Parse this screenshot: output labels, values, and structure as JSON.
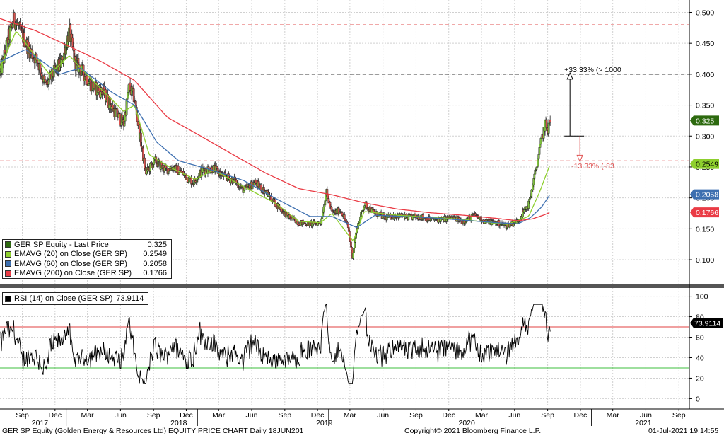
{
  "chart_data": [
    {
      "type": "candlestick",
      "ylim": [
        0.06,
        0.52
      ],
      "yticks": [
        0.1,
        0.15,
        0.2,
        0.25,
        0.3,
        0.35,
        0.4,
        0.45,
        0.5
      ],
      "ytick_labels": [
        "0.100",
        "0.150",
        "0.200",
        "0.250",
        "0.300",
        "0.350",
        "0.400",
        "0.450",
        "0.500"
      ],
      "grid": true,
      "legend_position": "bottom-left",
      "price_anchors": [
        [
          "2016-07-01",
          0.4
        ],
        [
          "2016-07-25",
          0.46
        ],
        [
          "2016-08-10",
          0.49
        ],
        [
          "2016-08-25",
          0.47
        ],
        [
          "2016-09-20",
          0.44
        ],
        [
          "2016-10-15",
          0.42
        ],
        [
          "2016-11-05",
          0.38
        ],
        [
          "2016-11-25",
          0.4
        ],
        [
          "2016-12-20",
          0.42
        ],
        [
          "2017-01-10",
          0.47
        ],
        [
          "2017-01-25",
          0.42
        ],
        [
          "2017-02-20",
          0.4
        ],
        [
          "2017-03-15",
          0.38
        ],
        [
          "2017-04-15",
          0.37
        ],
        [
          "2017-05-15",
          0.34
        ],
        [
          "2017-06-10",
          0.32
        ],
        [
          "2017-06-25",
          0.38
        ],
        [
          "2017-07-10",
          0.36
        ],
        [
          "2017-07-25",
          0.3
        ],
        [
          "2017-08-10",
          0.24
        ],
        [
          "2017-09-05",
          0.26
        ],
        [
          "2017-10-05",
          0.245
        ],
        [
          "2017-10-25",
          0.25
        ],
        [
          "2017-11-20",
          0.24
        ],
        [
          "2017-12-20",
          0.225
        ],
        [
          "2018-01-15",
          0.245
        ],
        [
          "2018-02-15",
          0.248
        ],
        [
          "2018-03-15",
          0.235
        ],
        [
          "2018-04-15",
          0.228
        ],
        [
          "2018-05-10",
          0.212
        ],
        [
          "2018-06-10",
          0.225
        ],
        [
          "2018-07-10",
          0.21
        ],
        [
          "2018-08-10",
          0.188
        ],
        [
          "2018-09-10",
          0.17
        ],
        [
          "2018-10-10",
          0.16
        ],
        [
          "2018-11-10",
          0.158
        ],
        [
          "2018-12-10",
          0.16
        ],
        [
          "2018-12-25",
          0.21
        ],
        [
          "2019-01-10",
          0.175
        ],
        [
          "2019-02-05",
          0.18
        ],
        [
          "2019-02-25",
          0.15
        ],
        [
          "2019-03-08",
          0.105
        ],
        [
          "2019-03-20",
          0.15
        ],
        [
          "2019-04-10",
          0.19
        ],
        [
          "2019-05-10",
          0.175
        ],
        [
          "2019-06-10",
          0.168
        ],
        [
          "2019-07-10",
          0.172
        ],
        [
          "2019-08-10",
          0.168
        ],
        [
          "2019-09-10",
          0.17
        ],
        [
          "2019-10-10",
          0.165
        ],
        [
          "2019-11-10",
          0.165
        ],
        [
          "2019-12-10",
          0.168
        ],
        [
          "2020-01-10",
          0.162
        ],
        [
          "2020-02-10",
          0.172
        ],
        [
          "2020-03-10",
          0.162
        ],
        [
          "2020-04-10",
          0.16
        ],
        [
          "2020-05-10",
          0.155
        ],
        [
          "2020-06-10",
          0.163
        ],
        [
          "2020-07-10",
          0.19
        ],
        [
          "2020-07-25",
          0.23
        ],
        [
          "2020-08-10",
          0.28
        ],
        [
          "2020-08-25",
          0.32
        ],
        [
          "2020-09-01",
          0.31
        ],
        [
          "2020-09-08",
          0.325
        ]
      ],
      "ema_anchors": {
        "EMAVG (20)": [
          [
            "2016-07-01",
            0.41
          ],
          [
            "2016-08-15",
            0.47
          ],
          [
            "2016-11-15",
            0.4
          ],
          [
            "2017-01-10",
            0.43
          ],
          [
            "2017-03-15",
            0.39
          ],
          [
            "2017-06-10",
            0.34
          ],
          [
            "2017-07-10",
            0.35
          ],
          [
            "2017-08-20",
            0.27
          ],
          [
            "2017-10-15",
            0.25
          ],
          [
            "2017-12-25",
            0.23
          ],
          [
            "2018-02-15",
            0.245
          ],
          [
            "2018-05-10",
            0.218
          ],
          [
            "2018-08-10",
            0.19
          ],
          [
            "2018-10-10",
            0.162
          ],
          [
            "2018-12-10",
            0.16
          ],
          [
            "2019-01-10",
            0.175
          ],
          [
            "2019-03-10",
            0.13
          ],
          [
            "2019-04-10",
            0.178
          ],
          [
            "2019-07-10",
            0.172
          ],
          [
            "2020-01-10",
            0.165
          ],
          [
            "2020-05-10",
            0.157
          ],
          [
            "2020-07-10",
            0.17
          ],
          [
            "2020-08-10",
            0.21
          ],
          [
            "2020-09-08",
            0.2549
          ]
        ],
        "EMAVG (60)": [
          [
            "2016-07-01",
            0.42
          ],
          [
            "2016-09-10",
            0.44
          ],
          [
            "2016-12-15",
            0.4
          ],
          [
            "2017-02-10",
            0.41
          ],
          [
            "2017-05-10",
            0.37
          ],
          [
            "2017-07-10",
            0.35
          ],
          [
            "2017-09-10",
            0.29
          ],
          [
            "2017-11-10",
            0.26
          ],
          [
            "2018-02-10",
            0.245
          ],
          [
            "2018-05-10",
            0.228
          ],
          [
            "2018-08-10",
            0.198
          ],
          [
            "2018-11-10",
            0.17
          ],
          [
            "2019-01-10",
            0.17
          ],
          [
            "2019-03-20",
            0.152
          ],
          [
            "2019-05-10",
            0.172
          ],
          [
            "2019-10-10",
            0.168
          ],
          [
            "2020-04-10",
            0.16
          ],
          [
            "2020-06-10",
            0.158
          ],
          [
            "2020-07-15",
            0.168
          ],
          [
            "2020-08-15",
            0.185
          ],
          [
            "2020-09-08",
            0.2058
          ]
        ],
        "EMAVG (200)": [
          [
            "2016-07-01",
            0.49
          ],
          [
            "2016-10-10",
            0.47
          ],
          [
            "2017-01-10",
            0.445
          ],
          [
            "2017-04-10",
            0.42
          ],
          [
            "2017-07-10",
            0.39
          ],
          [
            "2017-10-10",
            0.33
          ],
          [
            "2018-01-10",
            0.3
          ],
          [
            "2018-04-10",
            0.27
          ],
          [
            "2018-07-10",
            0.24
          ],
          [
            "2018-10-10",
            0.215
          ],
          [
            "2019-01-10",
            0.205
          ],
          [
            "2019-04-10",
            0.192
          ],
          [
            "2019-07-10",
            0.182
          ],
          [
            "2019-10-10",
            0.176
          ],
          [
            "2020-01-10",
            0.172
          ],
          [
            "2020-04-10",
            0.167
          ],
          [
            "2020-06-10",
            0.163
          ],
          [
            "2020-07-20",
            0.166
          ],
          [
            "2020-08-20",
            0.172
          ],
          [
            "2020-09-08",
            0.1766
          ]
        ]
      },
      "hlines": [
        {
          "y": 0.48,
          "color": "#e05252",
          "style": "dashed"
        },
        {
          "y": 0.4,
          "color": "#000000",
          "style": "dashed"
        },
        {
          "y": 0.26,
          "color": "#e05252",
          "style": "dashed"
        }
      ],
      "annotations": [
        {
          "text": "+33.33% (> 1000",
          "color": "#000000"
        },
        {
          "text": "-13.33% (-83.",
          "color": "#e05252"
        }
      ],
      "series": [
        {
          "name": "GER SP Equity - Last Price",
          "last": "0.325",
          "color": "#2d6a0f",
          "label_text_color": "#ffffff"
        },
        {
          "name": "EMAVG (20)  on Close (GER SP)",
          "last": "0.2549",
          "color": "#8ecf2e",
          "label_text_color": "#000000"
        },
        {
          "name": "EMAVG (60)  on Close (GER SP)",
          "last": "0.2058",
          "color": "#3d6fb0",
          "label_text_color": "#ffffff"
        },
        {
          "name": "EMAVG (200)  on Close (GER SP)",
          "last": "0.1766",
          "color": "#ea3b45",
          "label_text_color": "#ffffff"
        }
      ]
    },
    {
      "type": "line",
      "ylim": [
        -8,
        108
      ],
      "yticks": [
        0,
        20,
        40,
        60,
        80,
        100
      ],
      "ytick_labels": [
        "0",
        "20",
        "40",
        "60",
        "80",
        "100"
      ],
      "grid": true,
      "overbought": 70,
      "oversold": 30,
      "series": [
        {
          "name": "RSI (14)  on Close (GER SP)",
          "last": "73.9114",
          "color": "#000000"
        }
      ]
    }
  ],
  "xaxis": {
    "start": "2016-07-01",
    "end": "2021-09-30",
    "month_ticks": [
      {
        "label": "Sep",
        "date": "2016-09-01"
      },
      {
        "label": "Dec",
        "date": "2016-12-01"
      },
      {
        "label": "Mar",
        "date": "2017-03-01"
      },
      {
        "label": "Jun",
        "date": "2017-06-01"
      },
      {
        "label": "Sep",
        "date": "2017-09-01"
      },
      {
        "label": "Dec",
        "date": "2017-12-01"
      },
      {
        "label": "Mar",
        "date": "2018-03-01"
      },
      {
        "label": "Jun",
        "date": "2018-06-01"
      },
      {
        "label": "Sep",
        "date": "2018-09-01"
      },
      {
        "label": "Dec",
        "date": "2018-12-01"
      },
      {
        "label": "Mar",
        "date": "2019-03-01"
      },
      {
        "label": "Jun",
        "date": "2019-06-01"
      },
      {
        "label": "Sep",
        "date": "2019-09-01"
      },
      {
        "label": "Dec",
        "date": "2019-12-01"
      },
      {
        "label": "Mar",
        "date": "2020-03-01"
      },
      {
        "label": "Jun",
        "date": "2020-06-01"
      },
      {
        "label": "Sep",
        "date": "2020-09-01"
      },
      {
        "label": "Dec",
        "date": "2020-12-01"
      },
      {
        "label": "Mar",
        "date": "2021-03-01"
      },
      {
        "label": "Jun",
        "date": "2021-06-01"
      },
      {
        "label": "Sep",
        "date": "2021-09-01"
      }
    ],
    "year_labels": [
      {
        "label": "2017",
        "date": "2016-10-20"
      },
      {
        "label": "2018",
        "date": "2017-11-10"
      },
      {
        "label": "2019",
        "date": "2018-12-20"
      },
      {
        "label": "2020",
        "date": "2020-01-20"
      },
      {
        "label": "2021",
        "date": "2021-05-25"
      }
    ]
  },
  "footer": {
    "left": "GER SP Equity (Golden Energy & Resources Ltd) EQUITY PRICE CHART  Daily 18JUN201",
    "center": "Copyright© 2021 Bloomberg Finance L.P.",
    "right": "01-Jul-2021 19:14:55"
  }
}
